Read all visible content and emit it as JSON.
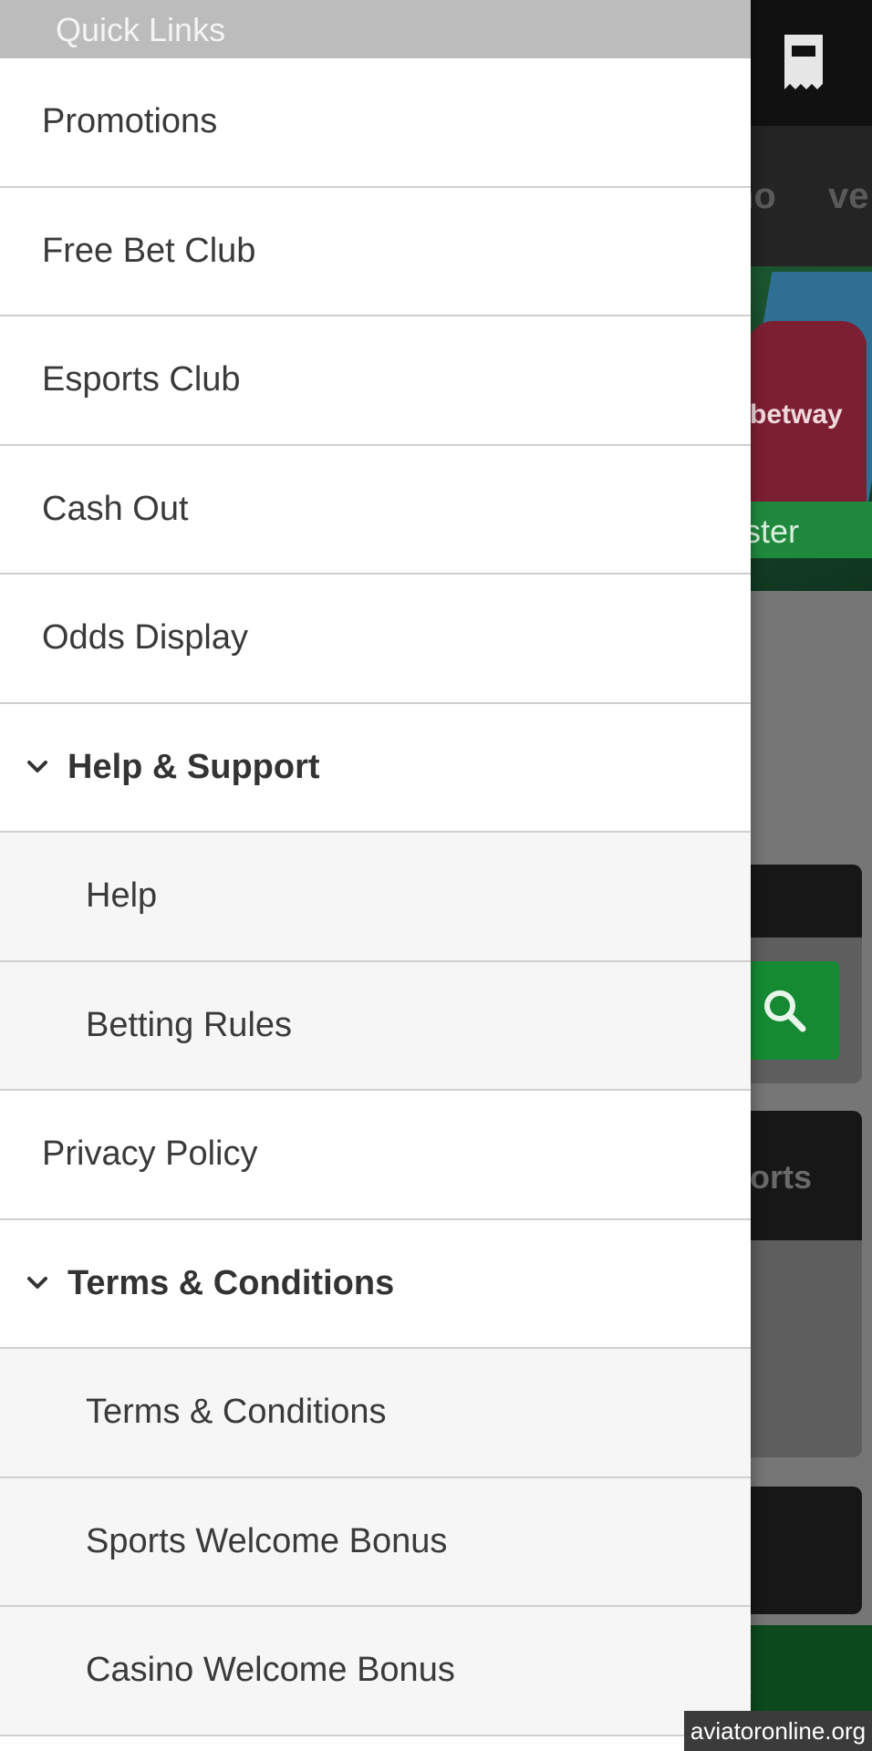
{
  "drawer": {
    "header_title": "Quick Links",
    "items": [
      {
        "label": "Promotions",
        "kind": "link"
      },
      {
        "label": "Free Bet Club",
        "kind": "link"
      },
      {
        "label": "Esports Club",
        "kind": "link"
      },
      {
        "label": "Cash Out",
        "kind": "link"
      },
      {
        "label": "Odds Display",
        "kind": "link"
      },
      {
        "label": "Help & Support",
        "kind": "group",
        "expanded": true,
        "icon": "chevron-down-icon"
      },
      {
        "label": "Help",
        "kind": "sublink"
      },
      {
        "label": "Betting Rules",
        "kind": "sublink"
      },
      {
        "label": "Privacy Policy",
        "kind": "link"
      },
      {
        "label": "Terms & Conditions",
        "kind": "group",
        "expanded": true,
        "icon": "chevron-down-icon"
      },
      {
        "label": "Terms & Conditions",
        "kind": "sublink"
      },
      {
        "label": "Sports Welcome Bonus",
        "kind": "sublink"
      },
      {
        "label": "Casino Welcome Bonus",
        "kind": "sublink"
      }
    ]
  },
  "background": {
    "nav_fragment_1": "no",
    "nav_fragment_2": "ve",
    "banner_shirt_text": "betway",
    "register_fragment": "ister",
    "sports_fragment": "orts",
    "green_bar_fragment": "r",
    "icons": [
      "betslip-icon",
      "search-icon"
    ]
  },
  "watermark": "aviatoronline.org",
  "colors": {
    "drawer_header": "#bcbcbc",
    "drawer_bg": "#ffffff",
    "sub_item_bg": "#f6f6f6",
    "divider": "#cfcfcf",
    "brand_green": "#158a33"
  }
}
